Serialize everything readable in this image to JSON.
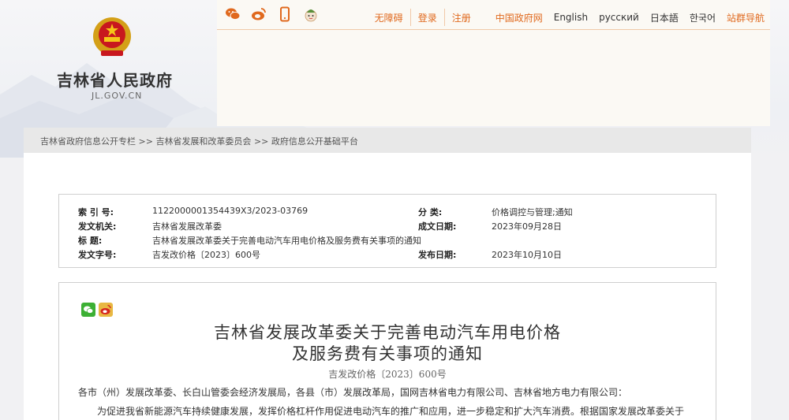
{
  "header": {
    "site_name": "吉林省人民政府",
    "site_url": "JL.GOV.CN",
    "share_icons": [
      "wechat-icon",
      "weibo-icon",
      "mobile-icon",
      "mascot-icon"
    ],
    "links": {
      "accessibility": "无障碍",
      "login": "登录",
      "register": "注册",
      "china_gov": "中国政府网",
      "english": "English",
      "russian": "русский",
      "japanese": "日本語",
      "korean": "한국어",
      "site_nav": "站群导航"
    },
    "accent_color": "#e0691e"
  },
  "breadcrumb": {
    "item1": "吉林省政府信息公开专栏",
    "item2": "吉林省发展和改革委员会",
    "item3": "政府信息公开基础平台",
    "sep": ">>"
  },
  "meta": {
    "index_label": "索 引 号:",
    "index_value": "1122000001354439X3/2023-03769",
    "category_label": "分    类:",
    "category_value": "价格调控与管理;通知",
    "issuer_label": "发文机关:",
    "issuer_value": "吉林省发展改革委",
    "created_label": "成文日期:",
    "created_value": "2023年09月28日",
    "title_label": "标      题:",
    "title_value": "吉林省发展改革委关于完善电动汽车用电价格及服务费有关事项的通知",
    "docno_label": "发文字号:",
    "docno_value": "吉发改价格〔2023〕600号",
    "published_label": "发布日期:",
    "published_value": "2023年10月10日"
  },
  "article": {
    "title_line1": "吉林省发展改革委关于完善电动汽车用电价格",
    "title_line2": "及服务费有关事项的通知",
    "doc_number": "吉发改价格〔2023〕600号",
    "addressee": "各市（州）发展改革委、长白山管委会经济发展局，各县（市）发展改革局，国网吉林省电力有限公司、吉林省地方电力有限公司：",
    "body_start": "为促进我省新能源汽车持续健康发展，发挥价格杠杆作用促进电动汽车的推广和应用，进一步稳定和扩大汽车消费。根据国家发展改革委关于"
  }
}
